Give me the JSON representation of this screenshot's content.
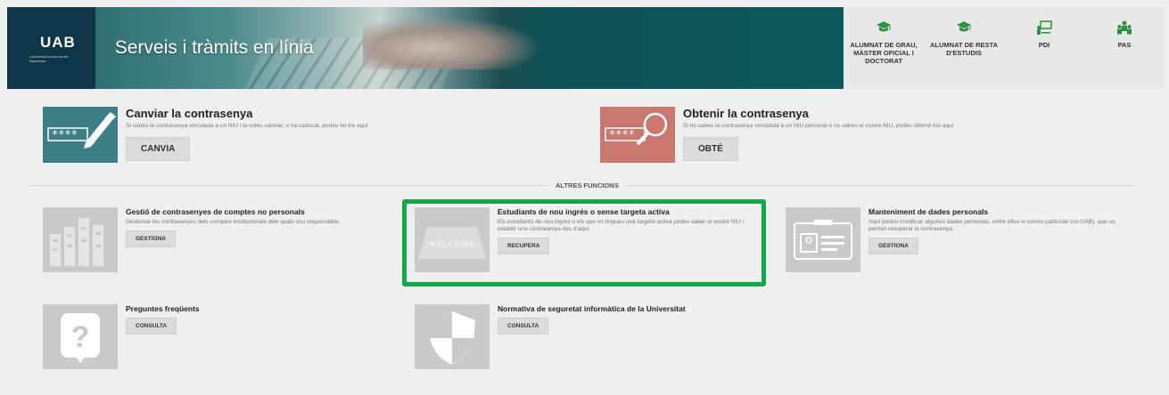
{
  "header": {
    "logo": "UAB",
    "logo_sub": "Universitat Autònoma de Barcelona",
    "title": "Serveis i tràmits en línia",
    "nav": [
      {
        "label": "ALUMNAT DE GRAU, MÀSTER OFICIAL I DOCTORAT",
        "icon": "graduation-cap-icon"
      },
      {
        "label": "ALUMNAT DE RESTA D'ESTUDIS",
        "icon": "graduation-cap-icon"
      },
      {
        "label": "PDI",
        "icon": "presentation-board-icon"
      },
      {
        "label": "PAS",
        "icon": "staff-group-icon"
      }
    ],
    "nav_color": "#2e8f3e"
  },
  "main": {
    "change_password": {
      "title": "Canviar la contrasenya",
      "desc": "Si sabeu la contrasenya vinculada a un NIU i la voleu canviar, o ha caducat, podeu fer-ho aquí",
      "button": "CANVIA",
      "icon": "password-pencil-icon",
      "color": "#3c7f86"
    },
    "obtain_password": {
      "title": "Obtenir la contrasenya",
      "desc": "Si no sabeu la contrasenya vinculada a un NIU personal o no sabeu el vostre NIU, podeu obtenir-los aquí",
      "button": "OBTÉ",
      "icon": "password-magnifier-icon",
      "color": "#c9776f"
    },
    "divider_label": "ALTRES FUNCIONS",
    "functions": [
      {
        "title": "Gestió de contrasenyes de comptes no personals",
        "desc": "Gestionar les contrasenyes dels comptes institucionals dels quals sou responsable.",
        "button": "GESTIONA",
        "icon": "servers-icon"
      },
      {
        "title": "Estudiants de nou ingrés o sense targeta activa",
        "desc": "Els estudiants de nou ingrés o els que no tingueu una targeta activa podeu saber el vostre NIU i establir una contrasenya des d'aquí.",
        "button": "RECUPERA",
        "icon": "welcome-mat-icon",
        "image_text": "WELCOME"
      },
      {
        "title": "Manteniment de dades personals",
        "desc": "Aquí podeu modificar algunes dades personals, entre elles el correu particular (no UAB), que us permet recuperar la contrasenya.",
        "button": "GESTIONA",
        "icon": "id-card-icon"
      },
      {
        "title": "Preguntes freqüents",
        "desc": "",
        "button": "CONSULTA",
        "icon": "question-bubble-icon"
      },
      {
        "title": "Normativa de seguretat informàtica de la Universitat",
        "desc": "",
        "button": "CONSULTA",
        "icon": "shield-icon"
      }
    ],
    "highlight_color": "#12a84a"
  }
}
